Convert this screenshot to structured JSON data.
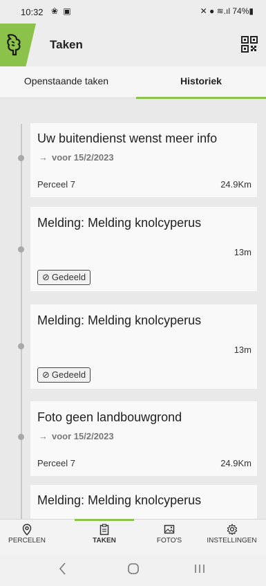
{
  "status_bar": {
    "time": "10:32",
    "left_icons": "❀ ▣",
    "right_icons": "✕ ● ≋.ıl 74%▮"
  },
  "header": {
    "title": "Taken",
    "qr_icon": "qr-code-icon"
  },
  "tabs": [
    {
      "label": "Openstaande taken",
      "active": false
    },
    {
      "label": "Historiek",
      "active": true
    }
  ],
  "tasks": [
    {
      "title": "Uw buitendienst wenst meer info",
      "due_arrow": "→",
      "due": "voor 15/2/2023",
      "field": "Perceel 7",
      "distance": "24.9Km"
    },
    {
      "title": "Melding: Melding knolcyperus",
      "distance": "13m",
      "badge": "Gedeeld",
      "badge_icon": "paperclip-icon"
    },
    {
      "title": "Melding: Melding knolcyperus",
      "distance": "13m",
      "badge": "Gedeeld",
      "badge_icon": "paperclip-icon"
    },
    {
      "title": "Foto geen landbouwgrond",
      "due_arrow": "→",
      "due": "voor 15/2/2023",
      "field": "Perceel 7",
      "distance": "24.9Km"
    },
    {
      "title": "Melding: Melding knolcyperus"
    }
  ],
  "bottom_nav": [
    {
      "label": "PERCELEN",
      "icon": "location-pin-icon",
      "active": false
    },
    {
      "label": "TAKEN",
      "icon": "clipboard-icon",
      "active": true
    },
    {
      "label": "FOTO'S",
      "icon": "photo-icon",
      "active": false
    },
    {
      "label": "INSTELLINGEN",
      "icon": "gear-icon",
      "active": false
    }
  ],
  "colors": {
    "accent": "#8bc34a",
    "background": "#e9e9e9",
    "card": "#f9f9f9"
  }
}
